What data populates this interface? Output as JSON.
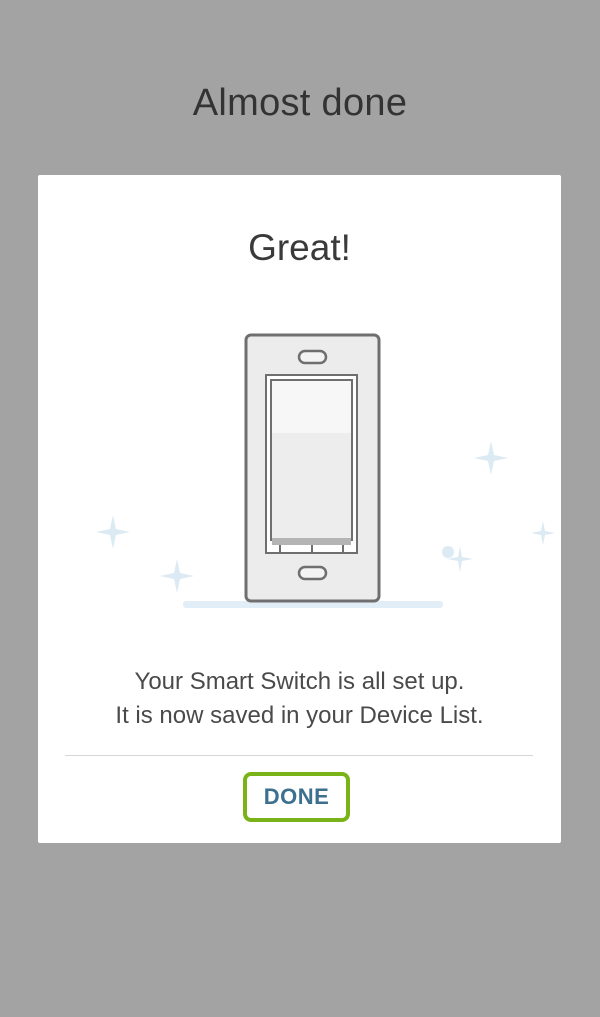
{
  "screen": {
    "title": "Almost done"
  },
  "dialog": {
    "title": "Great!",
    "message_line1": "Your Smart Switch is all set up.",
    "message_line2": "It is now saved in your Device List.",
    "done_label": "DONE"
  },
  "colors": {
    "background": "#a3a3a3",
    "dialog": "#ffffff",
    "button_text": "#3d6f8f",
    "button_highlight": "#7ab317",
    "sparkle": "#dceaf4"
  },
  "icons": [
    "smart-switch-illustration",
    "sparkle-icon",
    "dot-icon"
  ]
}
